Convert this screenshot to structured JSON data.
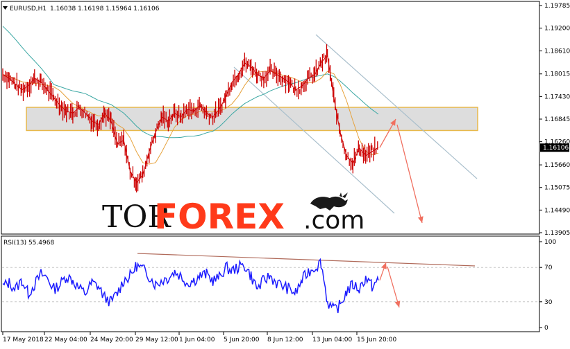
{
  "header": {
    "symbol": "EURUSD,H1",
    "ohlc": "1.16038 1.16198 1.15964 1.16106"
  },
  "watermark": {
    "part1": "TOR",
    "part2": "FOREX",
    "part3": ".com"
  },
  "rsi_label": "RSI(13) 55.4968",
  "colors": {
    "candle": "#cc0000",
    "ma_fast": "#e6a23c",
    "ma_slow": "#3aa7a3",
    "zone_fill": "#d9d9d9",
    "zone_border": "#e8b84a",
    "channel": "#a9bfcc",
    "forecast": "#f07060",
    "rsi": "#1c1cff",
    "rsi_trend": "#b06a5a",
    "price_tag": "#000000",
    "watermark_red": "#ff3a1a"
  },
  "chart_data": [
    {
      "type": "line",
      "title": "EURUSD,H1",
      "y_ticks": [
        "1.19785",
        "1.19200",
        "1.18610",
        "1.18015",
        "1.17430",
        "1.16845",
        "1.16260",
        "1.15660",
        "1.15075",
        "1.14490",
        "1.13905"
      ],
      "ylim": [
        1.13905,
        1.19785
      ],
      "x_ticks": [
        "17 May 2018",
        "22 May 04:00",
        "24 May 20:00",
        "29 May 12:00",
        "1 Jun 04:00",
        "5 Jun 20:00",
        "8 Jun 12:00",
        "13 Jun 04:00",
        "15 Jun 20:00"
      ],
      "last_price": "1.16106",
      "series": [
        {
          "values": [
            1.18,
            1.179,
            1.1775,
            1.176,
            1.177,
            1.179,
            1.178,
            1.176,
            1.174,
            1.172,
            1.1705,
            1.17,
            1.1715,
            1.17,
            1.168,
            1.167,
            1.17,
            1.168,
            1.162,
            1.163,
            1.155,
            1.152,
            1.154,
            1.16,
            1.165,
            1.169,
            1.168,
            1.17,
            1.169,
            1.171,
            1.1705,
            1.172,
            1.17,
            1.169,
            1.171,
            1.174,
            1.178,
            1.18,
            1.183,
            1.182,
            1.18,
            1.179,
            1.181,
            1.18,
            1.179,
            1.178,
            1.176,
            1.177,
            1.179,
            1.18,
            1.183,
            1.185,
            1.174,
            1.165,
            1.159,
            1.157,
            1.161,
            1.159,
            1.16,
            1.1611
          ]
        }
      ],
      "support_zone": [
        1.1655,
        1.1715
      ]
    },
    {
      "type": "line",
      "title": "RSI(13) 55.4968",
      "ylim": [
        0,
        100
      ],
      "y_ticks": [
        "100",
        "70",
        "30",
        "0"
      ],
      "series": [
        {
          "values": [
            48,
            52,
            45,
            55,
            40,
            50,
            62,
            58,
            45,
            50,
            60,
            55,
            45,
            40,
            52,
            48,
            35,
            30,
            40,
            55,
            60,
            72,
            68,
            60,
            50,
            55,
            58,
            65,
            60,
            52,
            55,
            60,
            62,
            55,
            58,
            70,
            66,
            70,
            72,
            60,
            45,
            55,
            60,
            52,
            48,
            45,
            40,
            55,
            65,
            70,
            76,
            30,
            20,
            26,
            42,
            50,
            45,
            58,
            48,
            55
          ]
        }
      ]
    }
  ]
}
